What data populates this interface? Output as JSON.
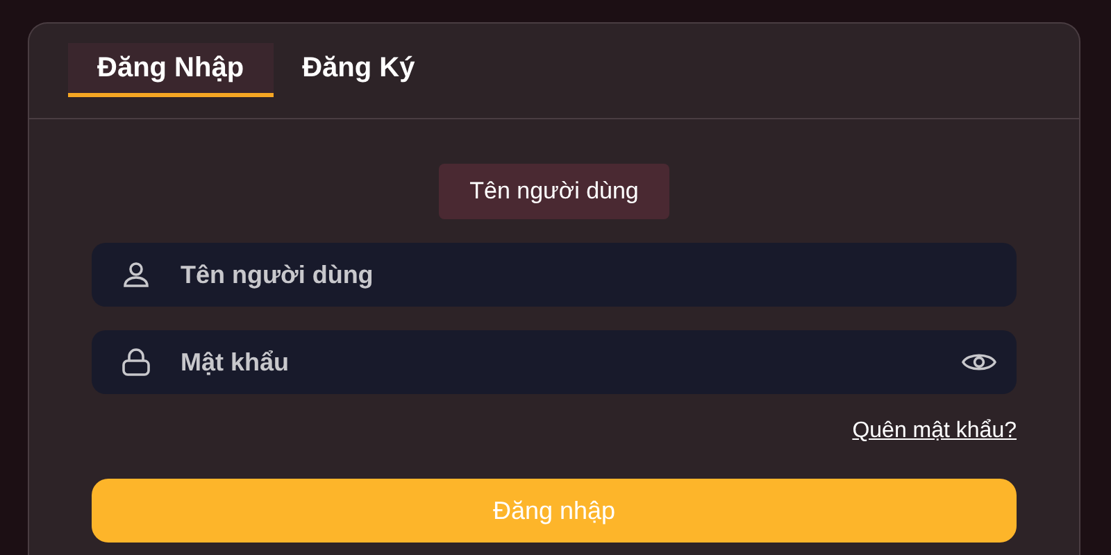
{
  "tabs": [
    {
      "label": "Đăng Nhập",
      "selected": true
    },
    {
      "label": "Đăng Ký",
      "selected": false
    }
  ],
  "hint": "Tên người dùng",
  "fields": [
    {
      "kind": "user",
      "placeholder": "Tên người dùng"
    },
    {
      "kind": "password",
      "placeholder": "Mật khẩu"
    }
  ],
  "forgot_link": "Quên mật khẩu?",
  "submit_button": "Đăng nhập"
}
